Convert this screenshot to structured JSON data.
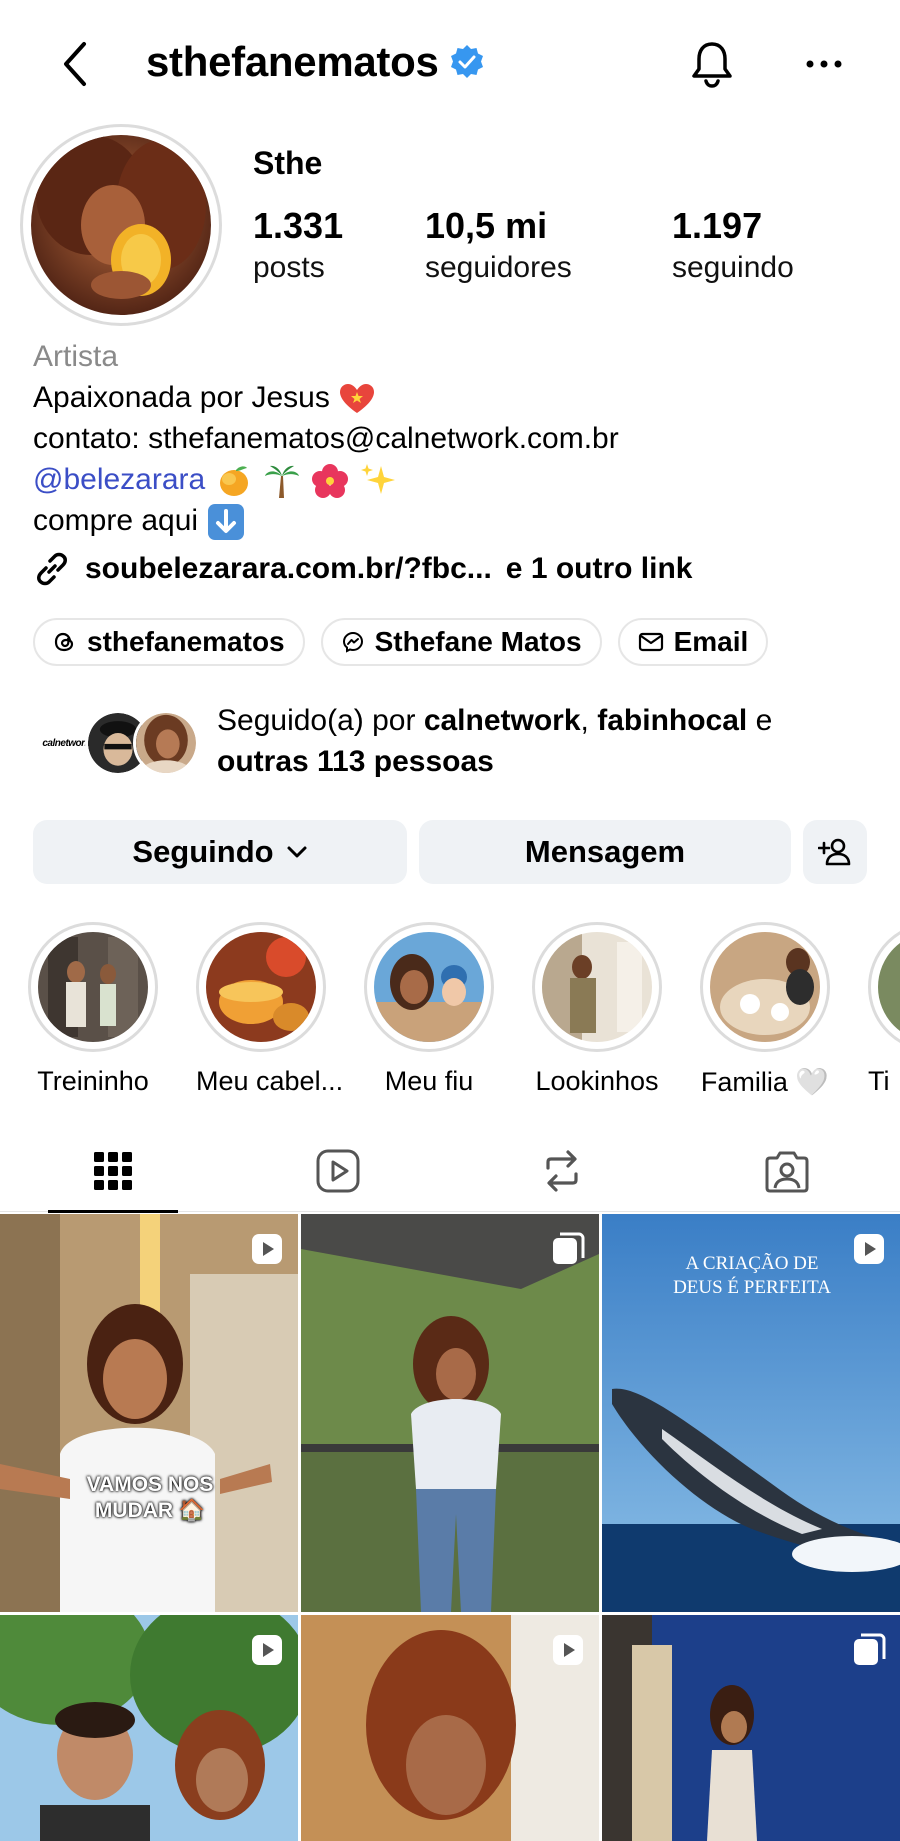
{
  "header": {
    "username": "sthefanematos"
  },
  "profile": {
    "display_name": "Sthe",
    "stats": [
      {
        "value": "1.331",
        "label": "posts"
      },
      {
        "value": "10,5 mi",
        "label": "seguidores"
      },
      {
        "value": "1.197",
        "label": "seguindo"
      }
    ]
  },
  "bio": {
    "category": "Artista",
    "line1": "Apaixonada por Jesus",
    "line2": "contato: sthefanematos@calnetwork.com.br",
    "mention": "@belezarara",
    "line4": "compre aqui",
    "link": "soubelezarara.com.br/?fbc...",
    "link_extra": "e 1 outro link"
  },
  "chips": {
    "threads": "sthefanematos",
    "messenger": "Sthefane Matos",
    "email": "Email"
  },
  "followed_by": {
    "prefix": "Seguido(a) por",
    "user1": "calnetwork",
    "sep": ",",
    "user2": "fabinhocal",
    "conj": "e",
    "others": "outras 113 pessoas",
    "avatar1_text": "calnetwork"
  },
  "actions": {
    "following": "Seguindo",
    "message": "Mensagem"
  },
  "highlights": [
    {
      "label": "Treininho"
    },
    {
      "label": "Meu cabel..."
    },
    {
      "label": "Meu fiu"
    },
    {
      "label": "Lookinhos"
    },
    {
      "label": "Familia 🤍"
    },
    {
      "label": "Ti"
    }
  ],
  "tabs": [
    "grid-icon",
    "reels-icon",
    "reposts-icon",
    "tagged-icon"
  ],
  "posts": {
    "post1_caption": "VAMOS NOS MUDAR 🏠",
    "post3_caption": "A CRIAÇÃO DE DEUS É PERFEITA"
  },
  "colors": {
    "verified": "#3797f0",
    "mention": "#3b4ec6",
    "button_bg": "#eff2f5"
  }
}
